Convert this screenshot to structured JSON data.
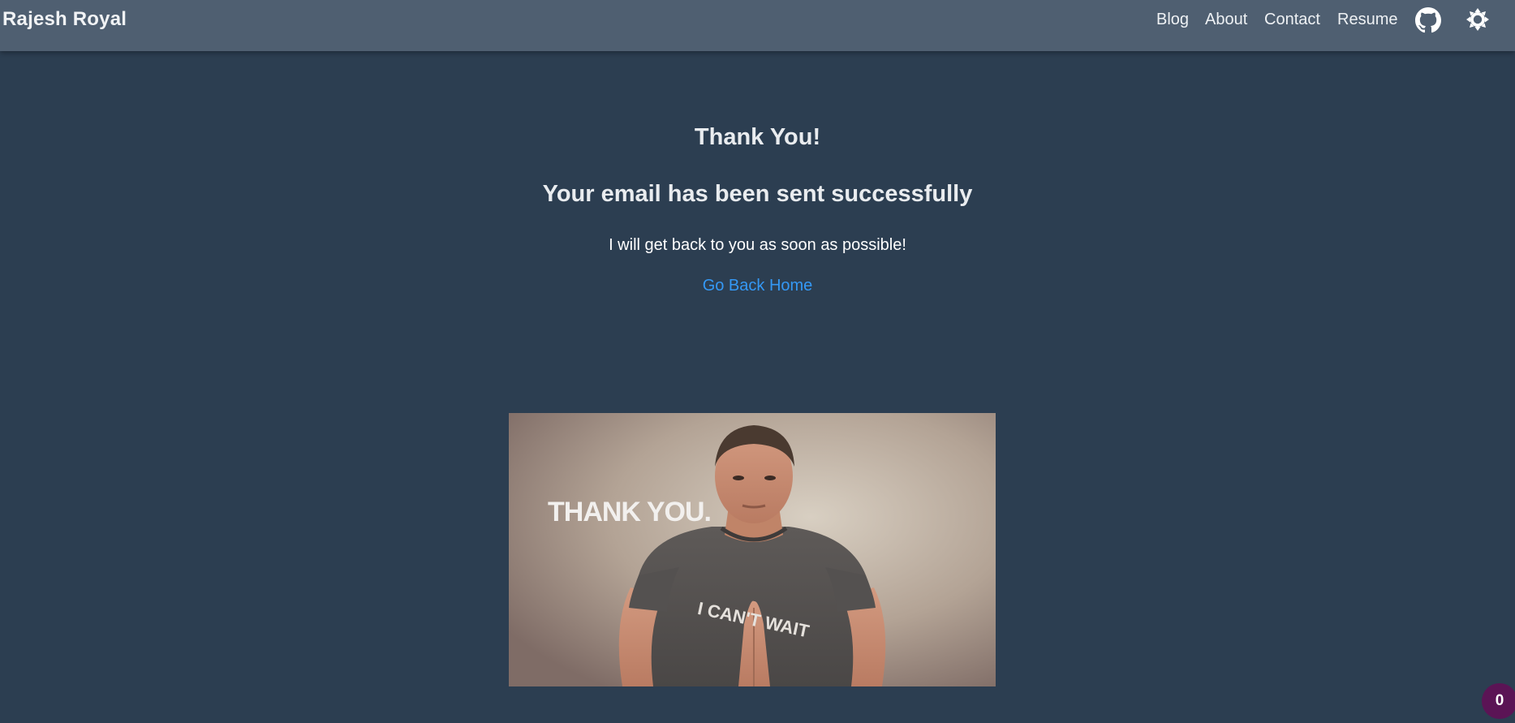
{
  "navbar": {
    "brand": "Rajesh Royal",
    "links": [
      "Blog",
      "About",
      "Contact",
      "Resume"
    ],
    "github_icon": "github-icon",
    "theme_icon": "sun-icon"
  },
  "main": {
    "heading": "Thank You!",
    "subheading": "Your email has been sent successfully",
    "message": "I will get back to you as soon as possible!",
    "home_link": "Go Back Home",
    "gif_caption": "THANK YOU.",
    "shirt_text": "I CAN'T WAIT"
  },
  "badge": {
    "count": "0"
  },
  "colors": {
    "background": "#2c3e51",
    "navbar": "#4f5f71",
    "link": "#3498f5",
    "badge": "#5b1455"
  }
}
